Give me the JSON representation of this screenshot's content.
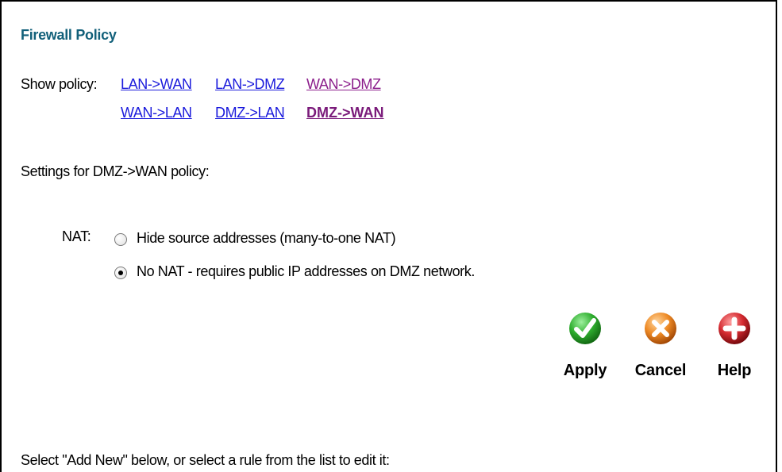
{
  "page": {
    "title": "Firewall Policy",
    "show_policy_label": "Show policy:",
    "settings_text": "Settings for DMZ->WAN policy:",
    "footer_text": "Select \"Add New\" below, or select a rule from the list to edit it:"
  },
  "policy_links": {
    "row1": [
      {
        "label": "LAN->WAN",
        "state": "unvisited"
      },
      {
        "label": "LAN->DMZ",
        "state": "unvisited"
      },
      {
        "label": "WAN->DMZ",
        "state": "visited"
      }
    ],
    "row2": [
      {
        "label": "WAN->LAN",
        "state": "unvisited"
      },
      {
        "label": "DMZ->LAN",
        "state": "unvisited"
      },
      {
        "label": "DMZ->WAN",
        "state": "active"
      }
    ]
  },
  "nat": {
    "label": "NAT:",
    "options": [
      {
        "label": "Hide source addresses (many-to-one NAT)",
        "checked": false
      },
      {
        "label": "No NAT - requires public IP addresses on DMZ network.",
        "checked": true
      }
    ]
  },
  "buttons": {
    "apply": {
      "label": "Apply",
      "icon": "check-icon",
      "color": "#2e9e2e"
    },
    "cancel": {
      "label": "Cancel",
      "icon": "x-icon",
      "color": "#e07a1a"
    },
    "help": {
      "label": "Help",
      "icon": "plus-icon",
      "color": "#c8202a"
    }
  },
  "colors": {
    "title": "#12607a",
    "link_unvisited": "#1a1adc",
    "link_visited": "#8b1d8b"
  }
}
